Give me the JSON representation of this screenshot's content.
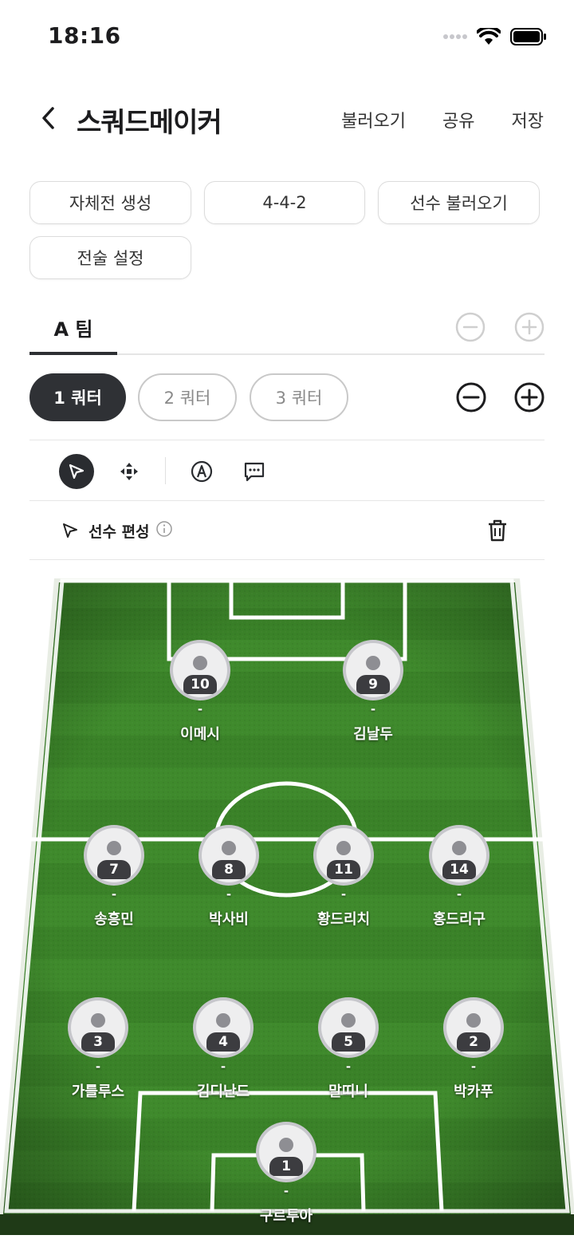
{
  "status": {
    "time": "18:16"
  },
  "header": {
    "title": "스쿼드메이커",
    "actions": {
      "load": "불러오기",
      "share": "공유",
      "save": "저장"
    }
  },
  "options": {
    "create_match": "자체전 생성",
    "formation": "4-4-2",
    "load_players": "선수 불러오기",
    "tactics": "전술 설정"
  },
  "teams": {
    "active_tab": "A 팀"
  },
  "quarters": [
    "1 쿼터",
    "2 쿼터",
    "3 쿼터"
  ],
  "editor": {
    "mode_label": "선수 편성"
  },
  "colors": {
    "dark": "#2f3135",
    "field_green": "#3f8a2c"
  },
  "players": [
    {
      "number": "10",
      "position": "-",
      "name": "이메시"
    },
    {
      "number": "9",
      "position": "-",
      "name": "김날두"
    },
    {
      "number": "7",
      "position": "-",
      "name": "송흥민"
    },
    {
      "number": "8",
      "position": "-",
      "name": "박사비"
    },
    {
      "number": "11",
      "position": "-",
      "name": "황드리치"
    },
    {
      "number": "14",
      "position": "-",
      "name": "홍드리구"
    },
    {
      "number": "3",
      "position": "-",
      "name": "가를루스"
    },
    {
      "number": "4",
      "position": "-",
      "name": "김디난드"
    },
    {
      "number": "5",
      "position": "-",
      "name": "말띠니"
    },
    {
      "number": "2",
      "position": "-",
      "name": "박카푸"
    },
    {
      "number": "1",
      "position": "-",
      "name": "구르투아"
    }
  ]
}
